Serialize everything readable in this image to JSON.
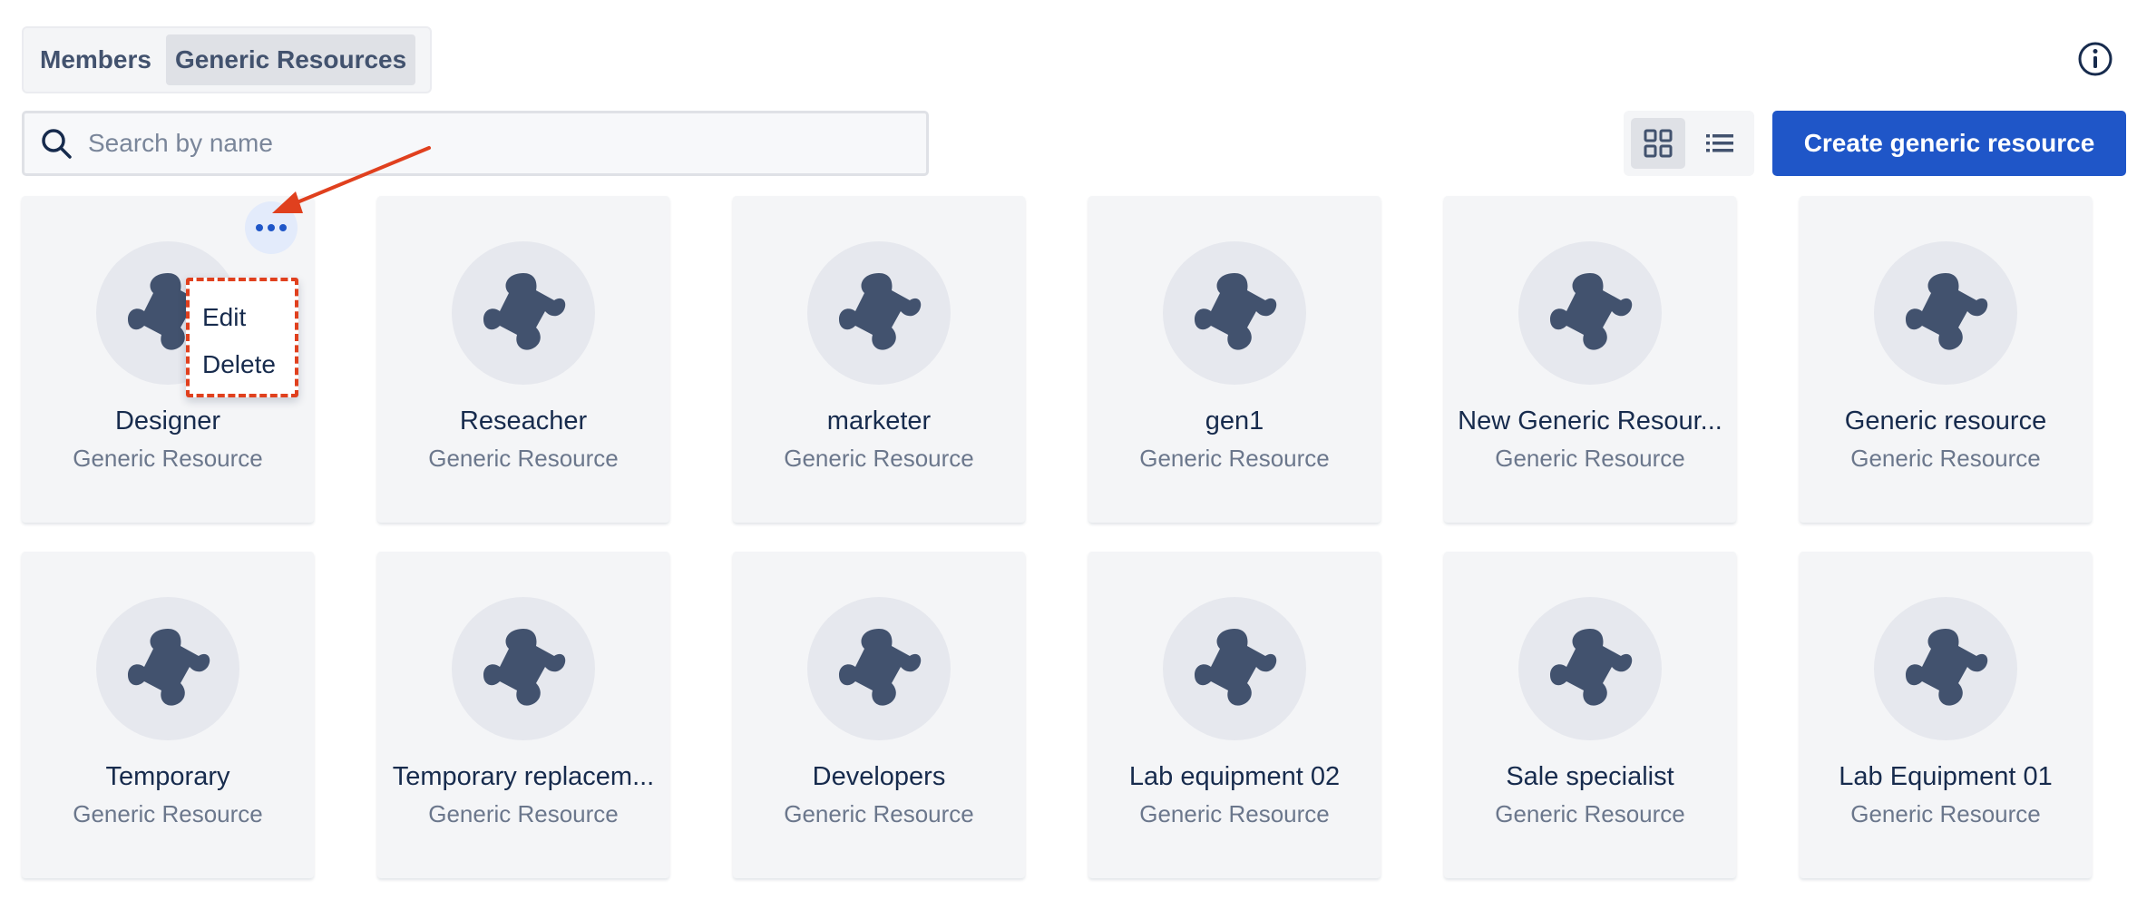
{
  "tabs": [
    {
      "label": "Members",
      "active": false
    },
    {
      "label": "Generic Resources",
      "active": true
    }
  ],
  "search": {
    "placeholder": "Search by name",
    "value": ""
  },
  "create_button_label": "Create generic resource",
  "icons": {
    "info": "info-icon",
    "search": "search-icon",
    "grid_view": "grid-view-icon",
    "list_view": "list-view-icon",
    "resource": "puzzle-icon",
    "more": "more-icon"
  },
  "colors": {
    "accent": "#1f56c8",
    "annotation": "#e0401e",
    "icon": "#42526e"
  },
  "resources": [
    {
      "name": "Designer",
      "type": "Generic Resource"
    },
    {
      "name": "Reseacher",
      "type": "Generic Resource"
    },
    {
      "name": "marketer",
      "type": "Generic Resource"
    },
    {
      "name": "gen1",
      "type": "Generic Resource"
    },
    {
      "name": "New Generic Resour...",
      "type": "Generic Resource"
    },
    {
      "name": "Generic resource",
      "type": "Generic Resource"
    },
    {
      "name": "Temporary",
      "type": "Generic Resource"
    },
    {
      "name": "Temporary replacem...",
      "type": "Generic Resource"
    },
    {
      "name": "Developers",
      "type": "Generic Resource"
    },
    {
      "name": "Lab equipment 02",
      "type": "Generic Resource"
    },
    {
      "name": "Sale specialist",
      "type": "Generic Resource"
    },
    {
      "name": "Lab Equipment 01",
      "type": "Generic Resource"
    }
  ],
  "context_menu": {
    "items": [
      {
        "label": "Edit"
      },
      {
        "label": "Delete"
      }
    ]
  }
}
